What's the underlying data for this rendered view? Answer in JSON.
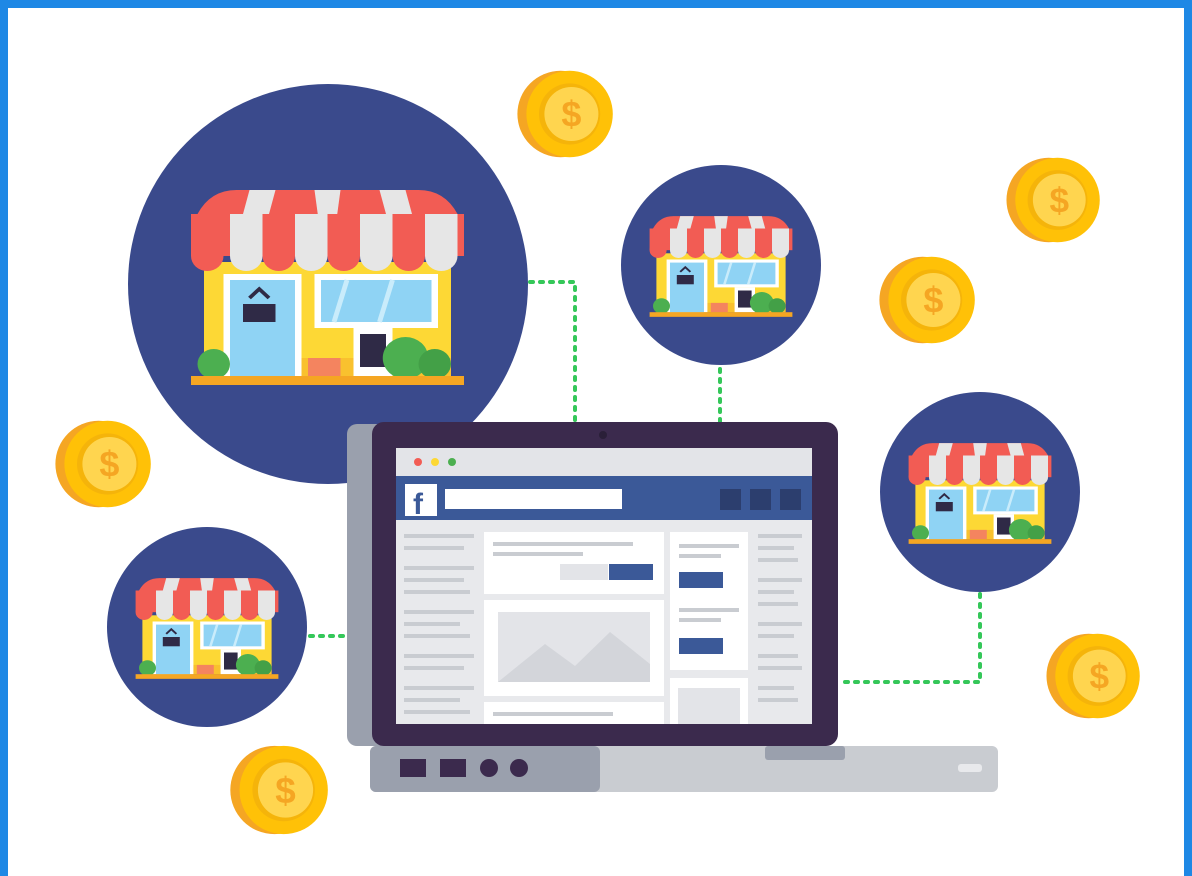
{
  "illustration": {
    "social_logo_letter": "f",
    "coin_symbol": "$",
    "colors": {
      "frame_border": "#1e88e5",
      "circle_bg": "#3a4a8c",
      "awning_red": "#f25c54",
      "awning_white": "#e6e6e6",
      "wall_yellow": "#fdd835",
      "window_blue": "#8fd3f4",
      "bush_green": "#4caf50",
      "laptop_dark": "#3b2a4d",
      "laptop_grey": "#c9ccd1",
      "facebook_blue": "#3b5998",
      "coin_gold": "#ffc107",
      "coin_dark": "#f5a623",
      "dotted_line": "#34c759"
    },
    "icons": [
      "store-icon",
      "laptop-icon",
      "coin-icon",
      "facebook-logo-icon",
      "mountain-image-icon"
    ]
  }
}
